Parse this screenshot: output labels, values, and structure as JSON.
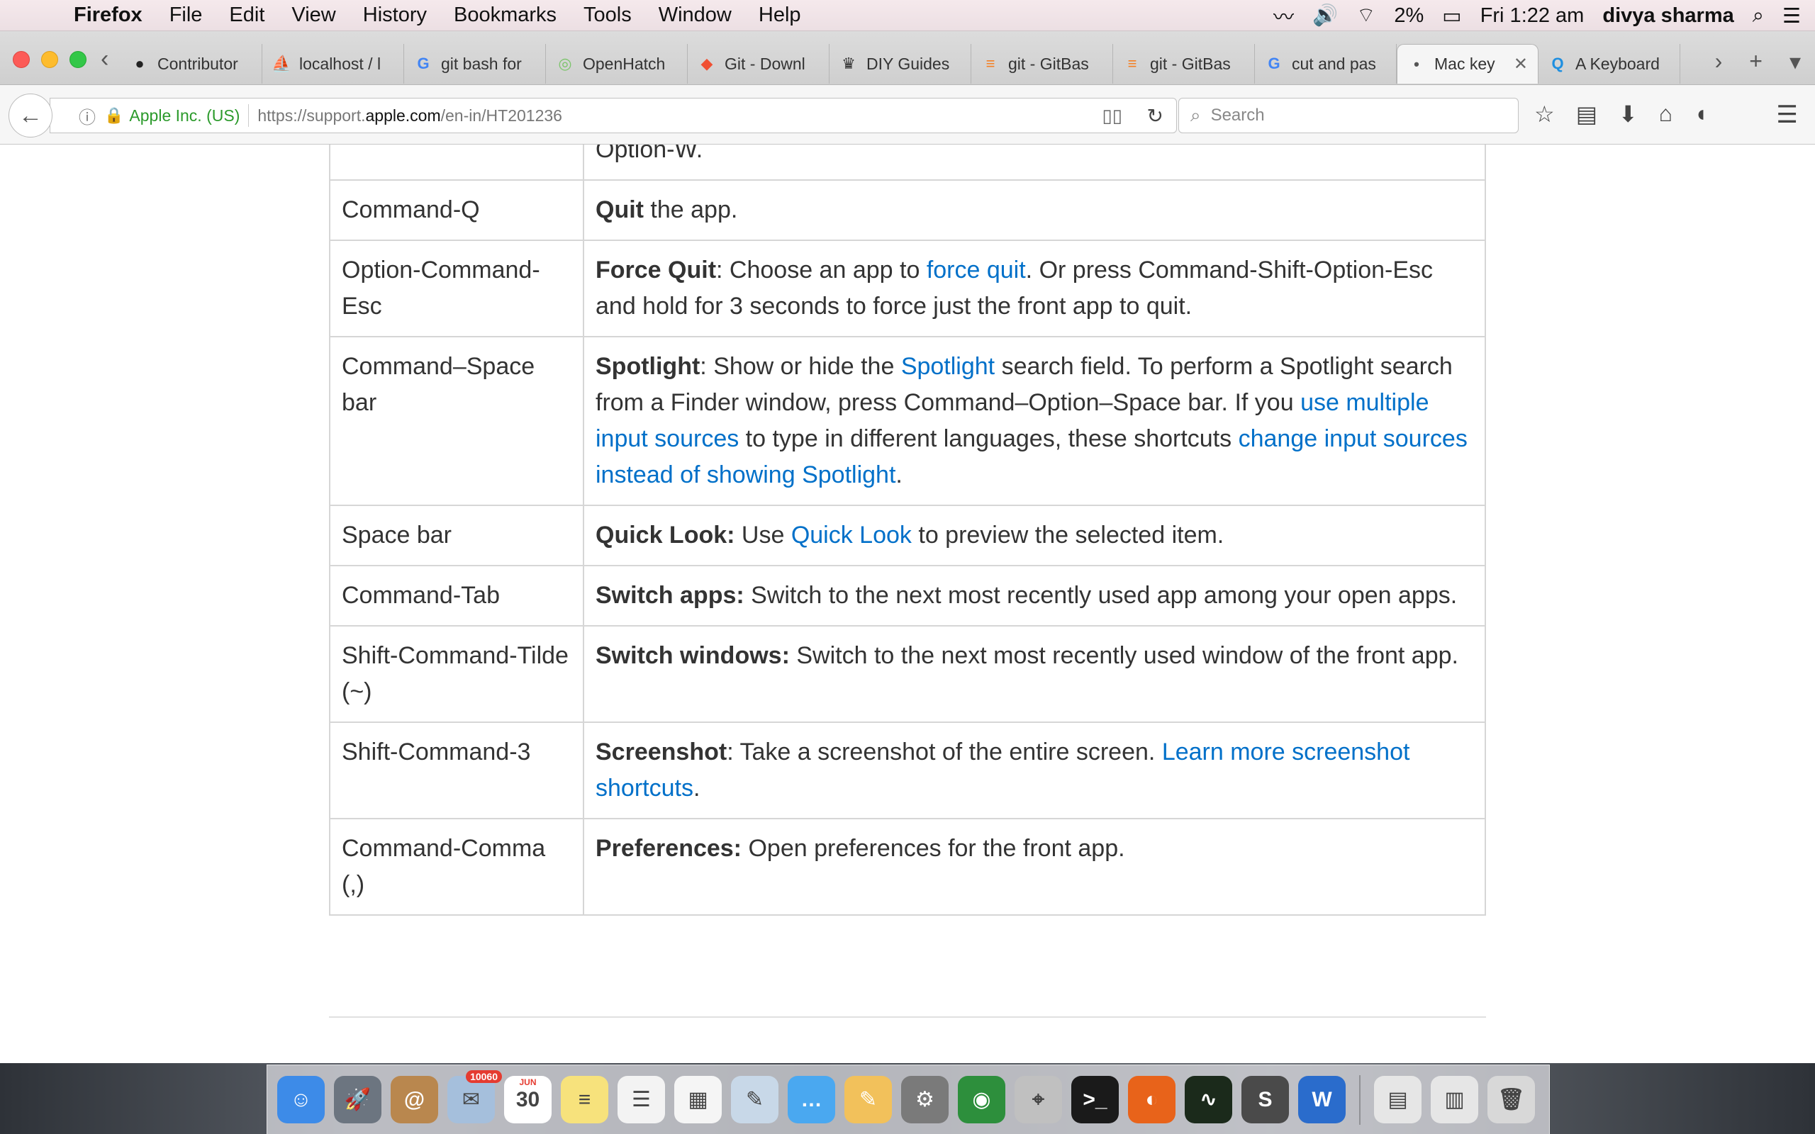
{
  "menubar": {
    "app": "Firefox",
    "items": [
      "File",
      "Edit",
      "View",
      "History",
      "Bookmarks",
      "Tools",
      "Window",
      "Help"
    ],
    "battery": "2%",
    "clock": "Fri 1:22 am",
    "user": "divya sharma"
  },
  "tabs": [
    {
      "label": "Contributor",
      "icon": "github-icon"
    },
    {
      "label": "localhost / l",
      "icon": "phpmyadmin-icon"
    },
    {
      "label": "git bash for",
      "icon": "google-icon"
    },
    {
      "label": "OpenHatch",
      "icon": "openhatch-icon"
    },
    {
      "label": "Git - Downl",
      "icon": "git-icon"
    },
    {
      "label": "DIY Guides",
      "icon": "diy-icon"
    },
    {
      "label": "git - GitBas",
      "icon": "stackoverflow-icon"
    },
    {
      "label": "git - GitBas",
      "icon": "stackoverflow-icon"
    },
    {
      "label": "cut and pas",
      "icon": "google-icon"
    },
    {
      "label": "Mac key",
      "icon": "apple-icon",
      "active": true
    },
    {
      "label": "A Keyboard",
      "icon": "keyboard-site-icon"
    }
  ],
  "navbar": {
    "site_identity": "Apple Inc. (US)",
    "url_prefix": "https://support.",
    "url_domain": "apple.com",
    "url_path": "/en-in/HT201236",
    "search_placeholder": "Search"
  },
  "rows": [
    {
      "key": "",
      "desc": [
        {
          "t": "Option-W."
        }
      ]
    },
    {
      "key": "Command-Q",
      "desc": [
        {
          "t": "Quit",
          "b": true
        },
        {
          "t": " the app."
        }
      ]
    },
    {
      "key": "Option-Command-Esc",
      "desc": [
        {
          "t": "Force Quit",
          "b": true
        },
        {
          "t": ": Choose an app to "
        },
        {
          "t": "force quit",
          "l": true
        },
        {
          "t": ". Or press Command-Shift-Option-Esc and hold for 3 seconds to force just the front app to quit."
        }
      ]
    },
    {
      "key": "Command–Space bar",
      "desc": [
        {
          "t": "Spotlight",
          "b": true
        },
        {
          "t": ": Show or hide the "
        },
        {
          "t": "Spotlight",
          "l": true
        },
        {
          "t": " search field. To perform a Spotlight search from a Finder window, press Command–Option–Space bar. If you "
        },
        {
          "t": "use multiple input sources",
          "l": true
        },
        {
          "t": " to type in different languages, these shortcuts "
        },
        {
          "t": "change input sources instead of showing Spotlight",
          "l": true
        },
        {
          "t": "."
        }
      ]
    },
    {
      "key": "Space bar",
      "desc": [
        {
          "t": "Quick Look:",
          "b": true
        },
        {
          "t": " Use "
        },
        {
          "t": "Quick Look",
          "l": true
        },
        {
          "t": " to preview the selected item."
        }
      ]
    },
    {
      "key": "Command-Tab",
      "desc": [
        {
          "t": "Switch apps:",
          "b": true
        },
        {
          "t": " Switch to the next most recently used app among your open apps."
        }
      ]
    },
    {
      "key": "Shift-Command-Tilde (~)",
      "desc": [
        {
          "t": "Switch windows:",
          "b": true
        },
        {
          "t": " Switch to the next most recently used window of the front app."
        }
      ]
    },
    {
      "key": "Shift-Command-3",
      "desc": [
        {
          "t": "Screenshot",
          "b": true
        },
        {
          "t": ": Take a screenshot of the entire screen. "
        },
        {
          "t": "Learn more screenshot shortcuts",
          "l": true
        },
        {
          "t": "."
        }
      ]
    },
    {
      "key": "Command-Comma (,)",
      "desc": [
        {
          "t": "Preferences:",
          "b": true
        },
        {
          "t": " Open preferences for the front app."
        }
      ]
    }
  ],
  "dock": {
    "apps": [
      {
        "name": "finder",
        "color": "#3d8be8",
        "glyph": "☺"
      },
      {
        "name": "launchpad",
        "color": "#6c7580",
        "glyph": "🚀"
      },
      {
        "name": "contacts",
        "color": "#b9874e",
        "glyph": "@"
      },
      {
        "name": "mail",
        "color": "#a5bfdc",
        "glyph": "✉",
        "badge": "10060"
      },
      {
        "name": "calendar",
        "color": "#ffffff",
        "glyph": "30",
        "sub": "JUN"
      },
      {
        "name": "notes",
        "color": "#f7e27c",
        "glyph": "≡"
      },
      {
        "name": "reminders",
        "color": "#f3f3f3",
        "glyph": "☰"
      },
      {
        "name": "app-grid",
        "color": "#f5f5f5",
        "glyph": "▦"
      },
      {
        "name": "preview",
        "color": "#c8d8e8",
        "glyph": "✎"
      },
      {
        "name": "messages",
        "color": "#4aa8f0",
        "glyph": "…"
      },
      {
        "name": "textedit",
        "color": "#f2c15b",
        "glyph": "✎"
      },
      {
        "name": "system-preferences",
        "color": "#7a7a7a",
        "glyph": "⚙"
      },
      {
        "name": "network-utility",
        "color": "#2d8f3c",
        "glyph": "◉"
      },
      {
        "name": "directory-utility",
        "color": "#c0c0c0",
        "glyph": "⌖"
      },
      {
        "name": "terminal",
        "color": "#1a1a1a",
        "glyph": ">_"
      },
      {
        "name": "firefox",
        "color": "#e8631a",
        "glyph": "◐"
      },
      {
        "name": "activity-monitor",
        "color": "#1b2a1b",
        "glyph": "∿"
      },
      {
        "name": "sublime-text",
        "color": "#4a4a4a",
        "glyph": "S"
      },
      {
        "name": "word",
        "color": "#2a6ccc",
        "glyph": "W"
      }
    ],
    "trailing": [
      {
        "name": "downloads-stack",
        "color": "#e6e6e6",
        "glyph": "▤"
      },
      {
        "name": "documents-stack",
        "color": "#e6e6e6",
        "glyph": "▥"
      },
      {
        "name": "trash",
        "color": "#d8d8d8",
        "glyph": "🗑"
      }
    ]
  }
}
